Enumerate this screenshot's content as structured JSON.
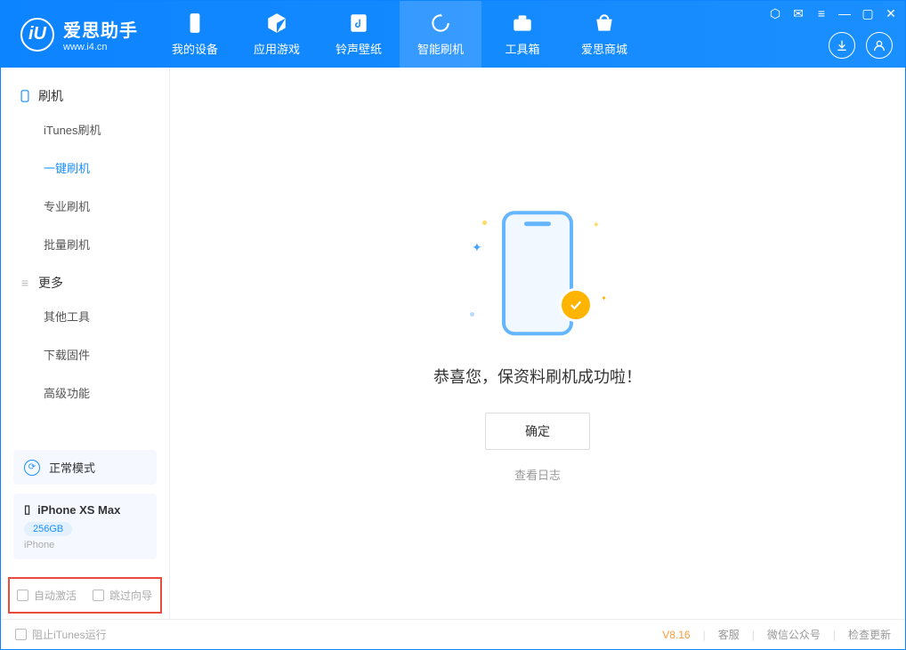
{
  "app": {
    "logo_letter": "iU",
    "title": "爱思助手",
    "subtitle": "www.i4.cn"
  },
  "nav": {
    "items": [
      {
        "label": "我的设备"
      },
      {
        "label": "应用游戏"
      },
      {
        "label": "铃声壁纸"
      },
      {
        "label": "智能刷机"
      },
      {
        "label": "工具箱"
      },
      {
        "label": "爱思商城"
      }
    ]
  },
  "sidebar": {
    "group1": {
      "title": "刷机",
      "items": [
        "iTunes刷机",
        "一键刷机",
        "专业刷机",
        "批量刷机"
      ],
      "active_index": 1
    },
    "group2": {
      "title": "更多",
      "items": [
        "其他工具",
        "下载固件",
        "高级功能"
      ]
    }
  },
  "device": {
    "mode_label": "正常模式",
    "name": "iPhone XS Max",
    "storage": "256GB",
    "type": "iPhone"
  },
  "options": {
    "auto_activate": "自动激活",
    "skip_guide": "跳过向导"
  },
  "main": {
    "success_text": "恭喜您，保资料刷机成功啦！",
    "ok_button": "确定",
    "view_log": "查看日志"
  },
  "footer": {
    "block_itunes": "阻止iTunes运行",
    "version": "V8.16",
    "links": [
      "客服",
      "微信公众号",
      "检查更新"
    ]
  }
}
